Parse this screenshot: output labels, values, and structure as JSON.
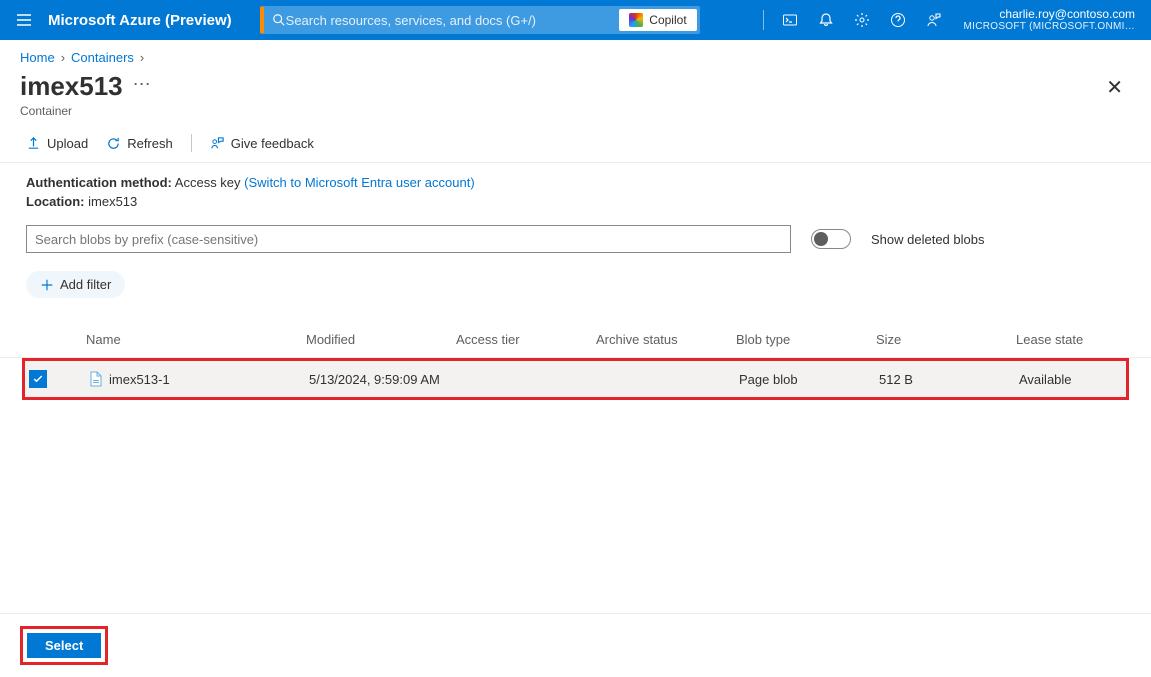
{
  "brand": "Microsoft Azure (Preview)",
  "search_placeholder": "Search resources, services, and docs (G+/)",
  "copilot_label": "Copilot",
  "user": {
    "email": "charlie.roy@contoso.com",
    "tenant": "MICROSOFT (MICROSOFT.ONMI…"
  },
  "breadcrumb": {
    "home": "Home",
    "containers": "Containers"
  },
  "page": {
    "title": "imex513",
    "subtitle": "Container"
  },
  "toolbar": {
    "upload": "Upload",
    "refresh": "Refresh",
    "feedback": "Give feedback"
  },
  "auth": {
    "method_label": "Authentication method:",
    "method_value": "Access key",
    "switch_link": "(Switch to Microsoft Entra user account)",
    "location_label": "Location:",
    "location_value": "imex513"
  },
  "blob_search_placeholder": "Search blobs by prefix (case-sensitive)",
  "toggle_label": "Show deleted blobs",
  "add_filter": "Add filter",
  "columns": {
    "name": "Name",
    "modified": "Modified",
    "access_tier": "Access tier",
    "archive_status": "Archive status",
    "blob_type": "Blob type",
    "size": "Size",
    "lease_state": "Lease state"
  },
  "rows": [
    {
      "name": "imex513-1",
      "modified": "5/13/2024, 9:59:09 AM",
      "access_tier": "",
      "archive_status": "",
      "blob_type": "Page blob",
      "size": "512 B",
      "lease_state": "Available"
    }
  ],
  "select_label": "Select"
}
